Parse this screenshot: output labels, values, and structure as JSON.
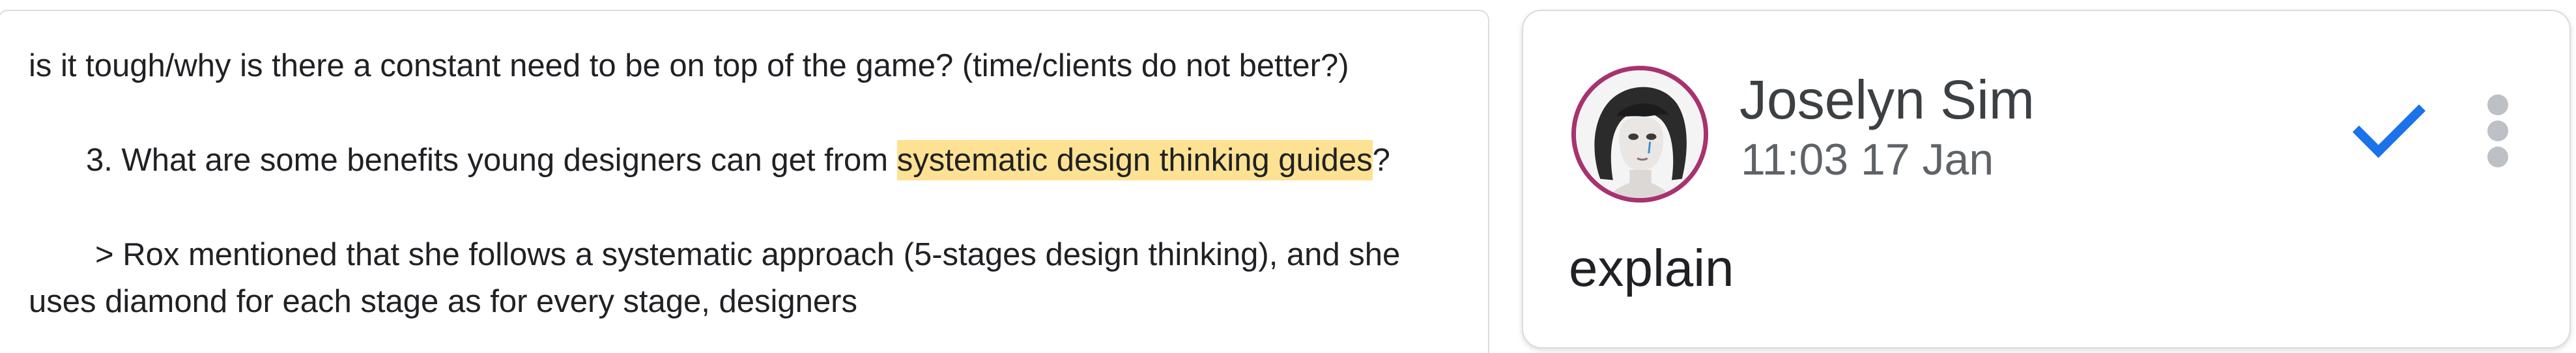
{
  "document": {
    "line_1": "is it tough/why is there a constant need to be on top of the game? (time/clients do not better?)",
    "line_2_before": "3. What are some benefits young designers can get from ",
    "line_2_highlight": "systematic design thinking guides",
    "line_2_after": "?",
    "line_3": "> Rox mentioned that she follows a systematic approach (5-stages design thinking), and she",
    "line_4": "uses diamond for each stage as for every stage, designers",
    "highlight_color": "#fde293"
  },
  "comment": {
    "author": "Joselyn Sim",
    "timestamp": "11:03 17 Jan",
    "body": "explain",
    "avatar_ring_color": "#a8326f",
    "resolve_icon": "checkmark-icon",
    "resolve_icon_color": "#1a73e8",
    "more_icon": "more-vertical-icon",
    "more_icon_color": "#bdc1c6"
  }
}
